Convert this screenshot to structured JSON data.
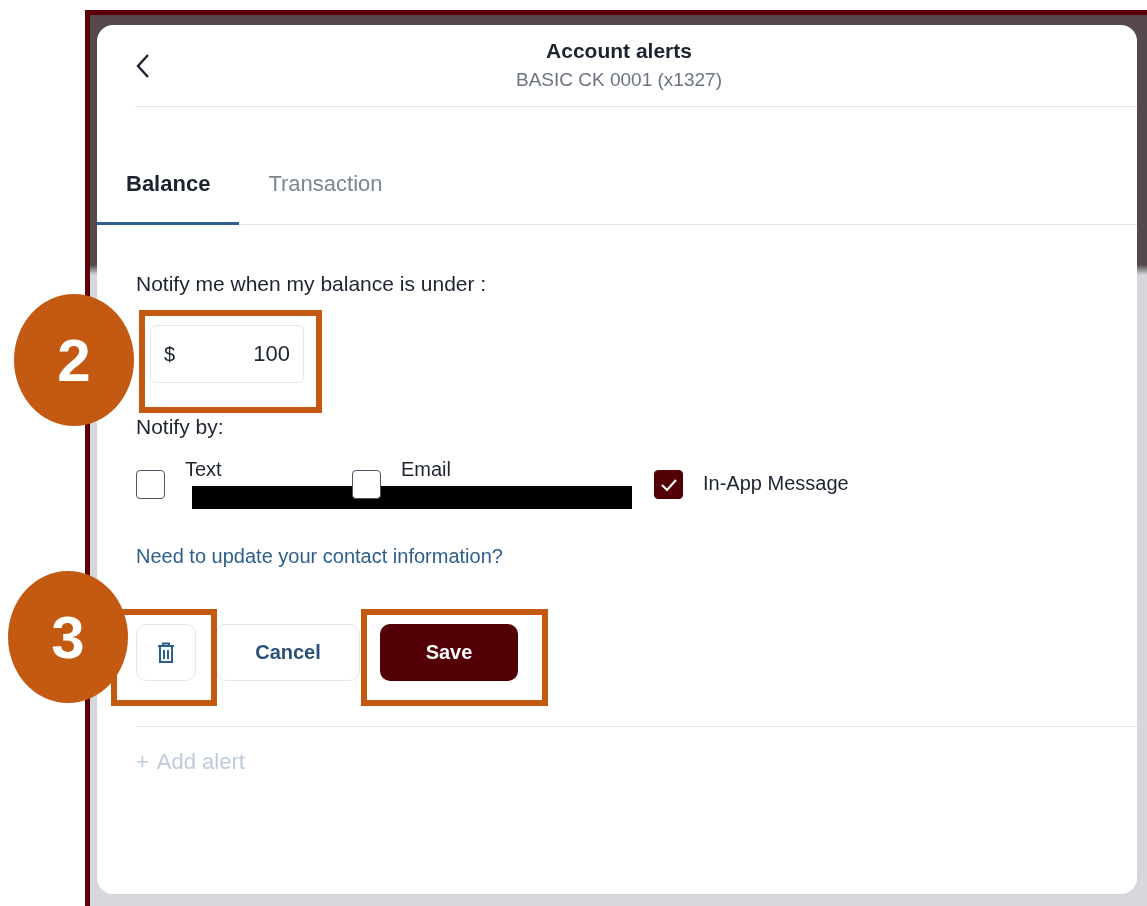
{
  "header": {
    "title": "Account alerts",
    "subtitle": "BASIC CK 0001 (x1327)"
  },
  "tabs": [
    {
      "label": "Balance",
      "selected": true
    },
    {
      "label": "Transaction",
      "selected": false
    }
  ],
  "threshold": {
    "label": "Notify me when my balance is under :",
    "currency": "$",
    "value": "100"
  },
  "notify_by": {
    "label": "Notify by:",
    "options": [
      {
        "label": "Text",
        "checked": false
      },
      {
        "label": "Email",
        "checked": false
      },
      {
        "label": "In-App Message",
        "checked": true
      }
    ]
  },
  "contact_link": "Need to update your contact information?",
  "actions": {
    "cancel": "Cancel",
    "save": "Save"
  },
  "add_alert": {
    "icon": "+",
    "label": "Add alert",
    "disabled": true
  },
  "annotations": [
    {
      "label": "2"
    },
    {
      "label": "3"
    }
  ]
}
